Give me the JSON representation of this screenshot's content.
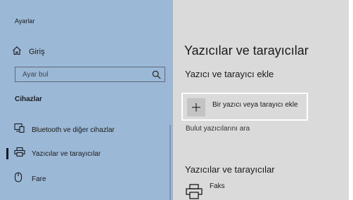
{
  "window": {
    "title": "Ayarlar"
  },
  "sidebar": {
    "home_label": "Giriş",
    "search": {
      "placeholder": "Ayar bul"
    },
    "section_title": "Cihazlar",
    "items": [
      {
        "label": "Bluetooth ve diğer cihazlar",
        "icon": "bluetooth-devices-icon",
        "selected": false
      },
      {
        "label": "Yazıcılar ve tarayıcılar",
        "icon": "printer-icon",
        "selected": true
      },
      {
        "label": "Fare",
        "icon": "mouse-icon",
        "selected": false
      }
    ]
  },
  "main": {
    "title": "Yazıcılar ve tarayıcılar",
    "add_section": {
      "heading": "Yazıcı ve tarayıcı ekle",
      "add_button_label": "Bir yazıcı veya tarayıcı ekle",
      "cloud_link": "Bulut yazıcılarını ara"
    },
    "list_section": {
      "heading": "Yazıcılar ve tarayıcılar",
      "printers": [
        {
          "name": "Faks",
          "icon": "fax-printer-icon"
        }
      ]
    }
  },
  "colors": {
    "sidebar_bg": "#9bb9d7",
    "main_bg": "#dadada",
    "text": "#1a1a1a",
    "focus_border": "#ffffff"
  }
}
